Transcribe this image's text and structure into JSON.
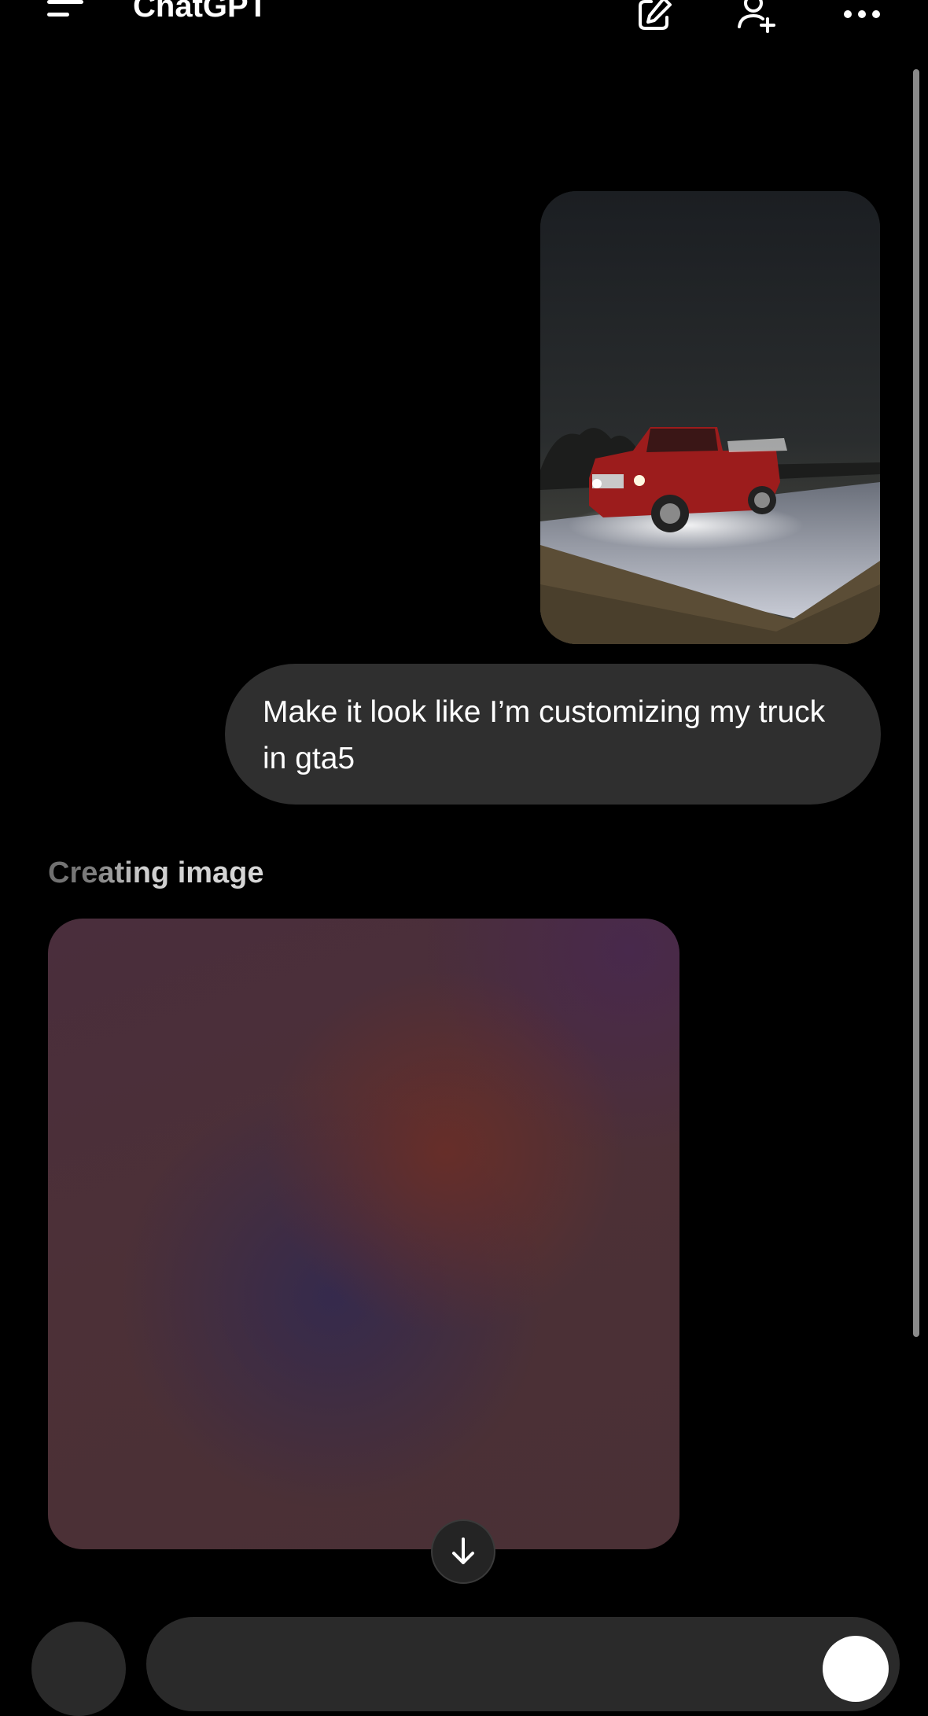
{
  "header": {
    "title": "ChatGPT",
    "menu_icon": "menu-icon",
    "compose_icon": "compose-icon",
    "add_person_icon": "add-person-icon",
    "more_icon": "more-icon"
  },
  "conversation": {
    "user_message": "Make it look like I’m customizing my truck in gta5",
    "status_label": "Creating image"
  },
  "icons": {
    "scroll_down": "arrow-down-icon"
  },
  "colors": {
    "background": "#000000",
    "bubble": "#2f2f2f",
    "text": "#ffffff"
  }
}
